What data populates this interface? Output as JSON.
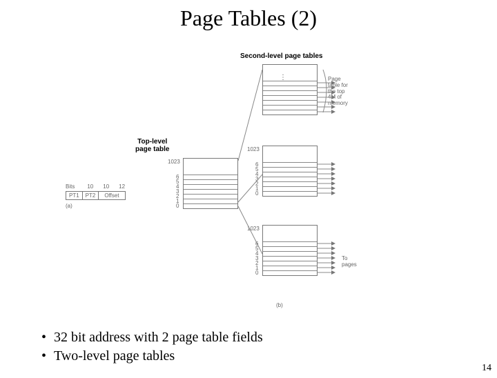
{
  "title": "Page Tables (2)",
  "labels": {
    "second_level": "Second-level page tables",
    "top_level_line1": "Top-level",
    "top_level_line2": "page table",
    "page_table_for_l1": "Page",
    "page_table_for_l2": "table for",
    "page_table_for_l3": "the top",
    "page_table_for_l4": "4M of",
    "page_table_for_l5": "memory",
    "to_pages_l1": "To",
    "to_pages_l2": "pages",
    "bits_label": "Bits",
    "bits_pt1": "10",
    "bits_pt2": "10",
    "bits_off": "12",
    "cell_pt1": "PT1",
    "cell_pt2": "PT2",
    "cell_off": "Offset",
    "a_label": "(a)",
    "b_label": "(b)",
    "num_1023": "1023",
    "n6": "6",
    "n5": "5",
    "n4": "4",
    "n3": "3",
    "n2": "2",
    "n1": "1",
    "n0": "0"
  },
  "bullets": {
    "b1": "32 bit address with 2 page table fields",
    "b2": "Two-level page tables"
  },
  "pagenum": "14"
}
